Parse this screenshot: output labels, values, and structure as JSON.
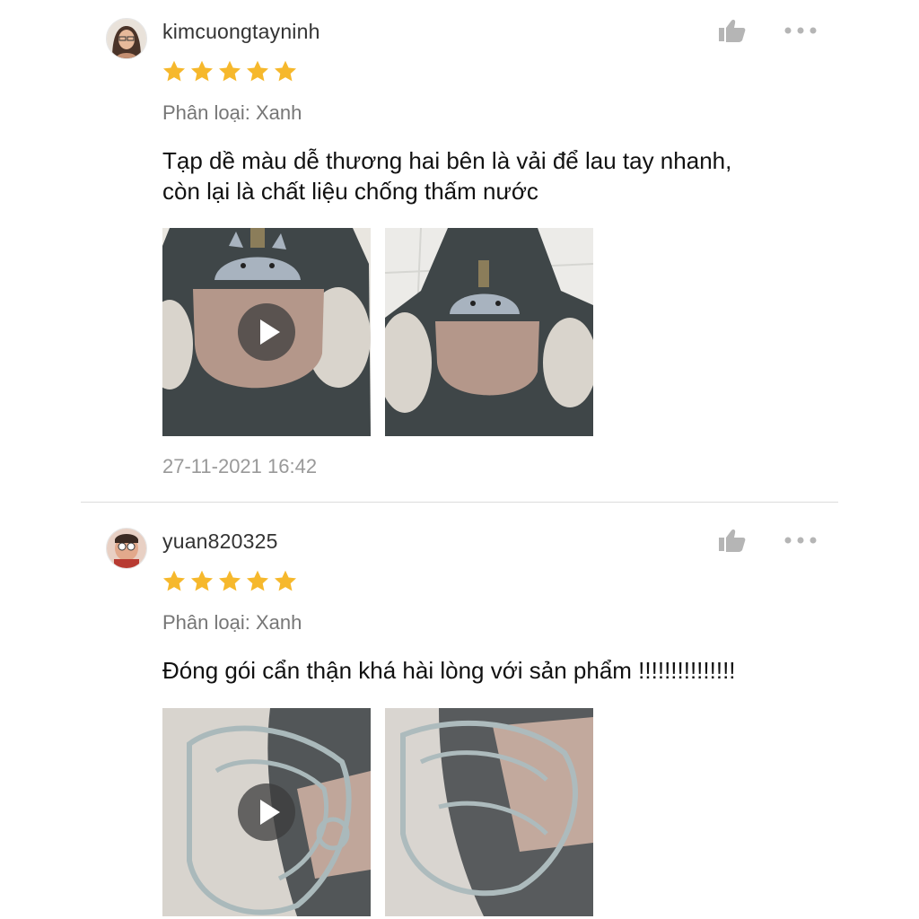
{
  "reviews": [
    {
      "username": "kimcuongtayninh",
      "rating": 5,
      "variant": "Phân loại: Xanh",
      "comment_lines": [
        "Tạp dề màu dễ thương hai bên là vải để lau tay nhanh,",
        "còn lại là chất liệu chống thấm nước"
      ],
      "media": [
        "video",
        "image"
      ],
      "timestamp": "27-11-2021 16:42"
    },
    {
      "username": "yuan820325",
      "rating": 5,
      "variant": "Phân loại: Xanh",
      "comment_lines": [
        "Đóng gói cẩn thận khá hài lòng với sản phẩm !!!!!!!!!!!!!!!"
      ],
      "media": [
        "video",
        "image"
      ]
    }
  ],
  "icons": {
    "like": "thumbs-up-icon",
    "more": "more-options-icon",
    "star": "star-icon",
    "play": "play-icon"
  },
  "colors": {
    "star": "#F6B82C",
    "icon": "#B5B5B5",
    "text_secondary": "#767676",
    "timestamp": "#999999"
  }
}
